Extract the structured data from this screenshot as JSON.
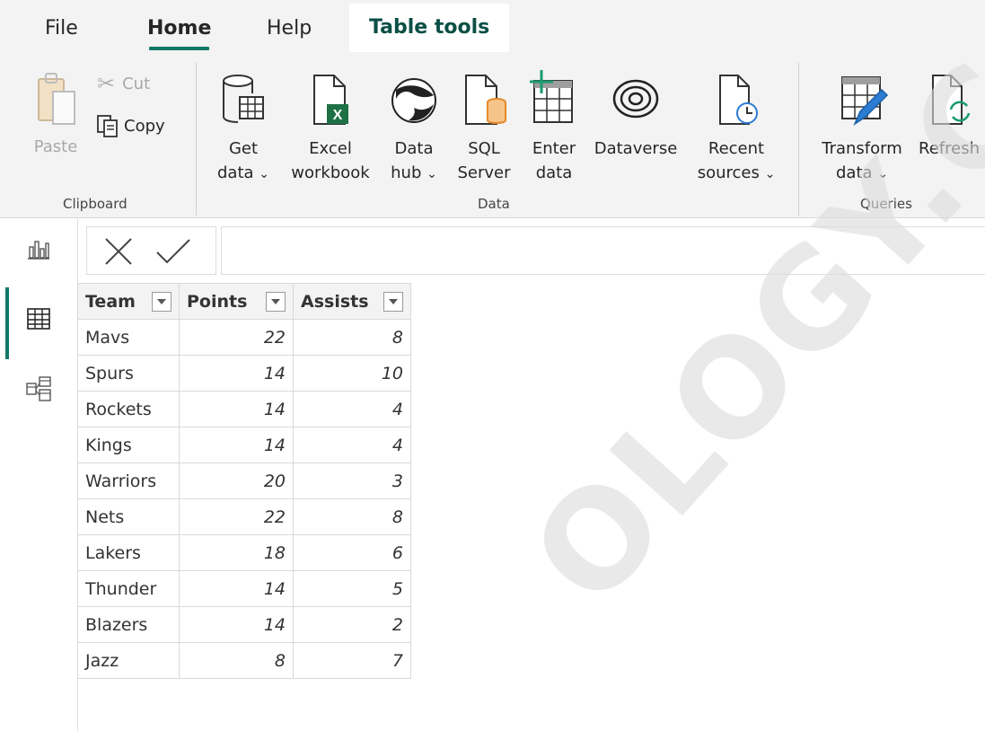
{
  "tabs": [
    {
      "label": "File"
    },
    {
      "label": "Home"
    },
    {
      "label": "Help"
    },
    {
      "label": "Table tools"
    }
  ],
  "ribbon": {
    "clipboard": {
      "group_label": "Clipboard",
      "paste": "Paste",
      "cut": "Cut",
      "copy": "Copy"
    },
    "data": {
      "group_label": "Data",
      "get_data": [
        "Get",
        "data"
      ],
      "excel_workbook": [
        "Excel",
        "workbook"
      ],
      "data_hub": [
        "Data",
        "hub"
      ],
      "sql_server": [
        "SQL",
        "Server"
      ],
      "enter_data": [
        "Enter",
        "data"
      ],
      "dataverse": [
        "Dataverse"
      ],
      "recent_sources": [
        "Recent",
        "sources"
      ]
    },
    "queries": {
      "group_label": "Queries",
      "transform_data": [
        "Transform",
        "data"
      ],
      "refresh": [
        "Refresh"
      ]
    },
    "chevron": "⌄"
  },
  "colors": {
    "accent": "#117865",
    "excel_green": "#1e7145",
    "sql_orange": "#e58a2a",
    "transform_blue": "#2b7cd3",
    "refresh_green": "#1a9b6e"
  },
  "table": {
    "columns": [
      "Team",
      "Points",
      "Assists"
    ],
    "rows": [
      [
        "Mavs",
        "22",
        "8"
      ],
      [
        "Spurs",
        "14",
        "10"
      ],
      [
        "Rockets",
        "14",
        "4"
      ],
      [
        "Kings",
        "14",
        "4"
      ],
      [
        "Warriors",
        "20",
        "3"
      ],
      [
        "Nets",
        "22",
        "8"
      ],
      [
        "Lakers",
        "18",
        "6"
      ],
      [
        "Thunder",
        "14",
        "5"
      ],
      [
        "Blazers",
        "14",
        "2"
      ],
      [
        "Jazz",
        "8",
        "7"
      ]
    ]
  },
  "watermark": "OLOGY.CO"
}
